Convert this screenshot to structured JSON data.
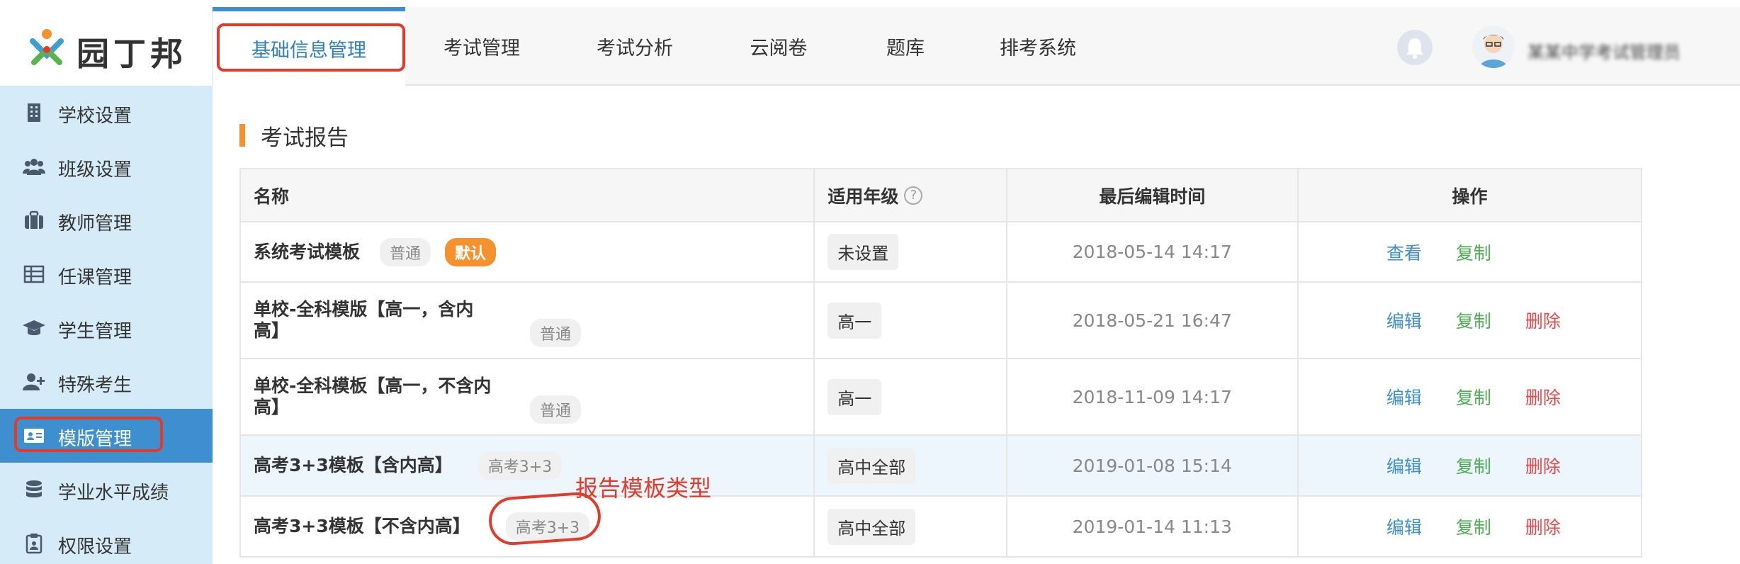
{
  "header": {
    "logo_text": "园丁邦",
    "nav": [
      {
        "label": "基础信息管理"
      },
      {
        "label": "考试管理"
      },
      {
        "label": "考试分析"
      },
      {
        "label": "云阅卷"
      },
      {
        "label": "题库"
      },
      {
        "label": "排考系统"
      }
    ],
    "username": "某某中学考试管理员"
  },
  "sidebar": {
    "items": [
      {
        "label": "学校设置",
        "icon": "building-icon"
      },
      {
        "label": "班级设置",
        "icon": "users-icon"
      },
      {
        "label": "教师管理",
        "icon": "briefcase-icon"
      },
      {
        "label": "任课管理",
        "icon": "table-icon"
      },
      {
        "label": "学生管理",
        "icon": "graduation-cap-icon"
      },
      {
        "label": "特殊考生",
        "icon": "user-plus-icon"
      },
      {
        "label": "模版管理",
        "icon": "id-card-icon"
      },
      {
        "label": "学业水平成绩",
        "icon": "database-icon"
      },
      {
        "label": "权限设置",
        "icon": "clipboard-icon"
      }
    ]
  },
  "main": {
    "section_title": "考试报告",
    "table": {
      "headers": {
        "name": "名称",
        "grade": "适用年级",
        "help": "?",
        "time": "最后编辑时间",
        "ops": "操作"
      },
      "rows": [
        {
          "name": "系统考试模板",
          "tag": "普通",
          "badge": "默认",
          "grade": "未设置",
          "time": "2018-05-14 14:17",
          "actions": [
            "查看",
            "复制"
          ]
        },
        {
          "name": "单校-全科模版【高一，含内高】",
          "tag": "普通",
          "grade": "高一",
          "time": "2018-05-21 16:47",
          "actions": [
            "编辑",
            "复制",
            "删除"
          ]
        },
        {
          "name": "单校-全科模板【高一，不含内高】",
          "tag": "普通",
          "grade": "高一",
          "time": "2018-11-09 14:17",
          "actions": [
            "编辑",
            "复制",
            "删除"
          ]
        },
        {
          "name": "高考3+3模板【含内高】",
          "tag": "高考3+3",
          "grade": "高中全部",
          "time": "2019-01-08 15:14",
          "actions": [
            "编辑",
            "复制",
            "删除"
          ]
        },
        {
          "name": "高考3+3模板【不含内高】",
          "tag": "高考3+3",
          "grade": "高中全部",
          "time": "2019-01-14 11:13",
          "actions": [
            "编辑",
            "复制",
            "删除"
          ]
        }
      ]
    },
    "annotation": "报告模板类型"
  },
  "colors": {
    "accent": "#3e8fd0",
    "orange": "#f5922f",
    "annotation": "#e23b2a"
  }
}
